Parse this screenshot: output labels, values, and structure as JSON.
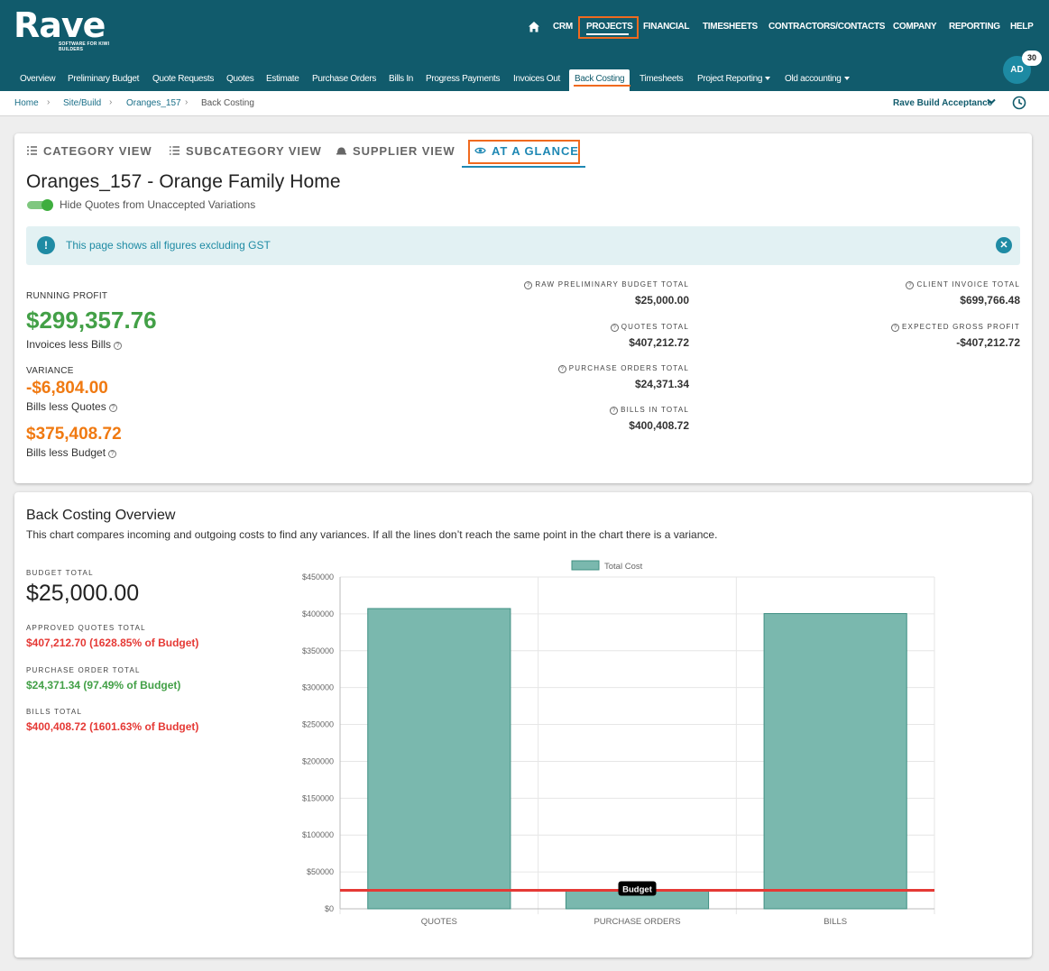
{
  "brand": {
    "name": "Rave",
    "tagline": "SOFTWARE FOR KIWI BUILDERS"
  },
  "main_nav": {
    "items": [
      "CRM",
      "PROJECTS",
      "FINANCIAL",
      "TIMESHEETS",
      "CONTRACTORS/CONTACTS",
      "COMPANY",
      "REPORTING",
      "HELP"
    ],
    "active": "PROJECTS"
  },
  "sub_nav": {
    "items": [
      "Overview",
      "Preliminary Budget",
      "Quote Requests",
      "Quotes",
      "Estimate",
      "Purchase Orders",
      "Bills In",
      "Progress Payments",
      "Invoices Out",
      "Back Costing",
      "Timesheets",
      "Project Reporting",
      "Old accounting"
    ],
    "active": "Back Costing"
  },
  "user": {
    "initials": "AD",
    "notification_count": "30"
  },
  "breadcrumb": {
    "items": [
      "Home",
      "Site/Build",
      "Oranges_157",
      "Back Costing"
    ]
  },
  "project_selector": "Rave Build Acceptance",
  "tabs": {
    "items": [
      "CATEGORY VIEW",
      "SUBCATEGORY VIEW",
      "SUPPLIER VIEW",
      "AT A GLANCE"
    ],
    "active": "AT A GLANCE"
  },
  "project": {
    "title": "Oranges_157 - Orange Family Home",
    "hide_quotes_toggle_label": "Hide Quotes from Unaccepted Variations",
    "hide_quotes_toggle_on": true
  },
  "alert": {
    "icon": "!",
    "text": "This page shows all figures excluding GST"
  },
  "summary": {
    "running_profit_label": "RUNNING PROFIT",
    "running_profit": "$299,357.76",
    "running_profit_sub": "Invoices less Bills",
    "variance_label": "VARIANCE",
    "variance": "-$6,804.00",
    "variance_sub": "Bills less Quotes",
    "budget_variance": "$375,408.72",
    "budget_variance_sub": "Bills less Budget"
  },
  "totals_mid": [
    {
      "label": "RAW PRELIMINARY BUDGET TOTAL",
      "value": "$25,000.00"
    },
    {
      "label": "QUOTES TOTAL",
      "value": "$407,212.72"
    },
    {
      "label": "PURCHASE ORDERS TOTAL",
      "value": "$24,371.34"
    },
    {
      "label": "BILLS IN TOTAL",
      "value": "$400,408.72"
    }
  ],
  "totals_right": [
    {
      "label": "CLIENT INVOICE TOTAL",
      "value": "$699,766.48"
    },
    {
      "label": "EXPECTED GROSS PROFIT",
      "value": "-$407,212.72"
    }
  ],
  "overview": {
    "title": "Back Costing Overview",
    "description": "This chart compares incoming and outgoing costs to find any variances. If all the lines don’t reach the same point in the chart there is a variance.",
    "budget_total_label": "BUDGET TOTAL",
    "budget_total": "$25,000.00",
    "approved_quotes_label": "APPROVED QUOTES TOTAL",
    "approved_quotes": "$407,212.70 (1628.85% of Budget)",
    "po_total_label": "PURCHASE ORDER TOTAL",
    "po_total": "$24,371.34 (97.49% of Budget)",
    "bills_total_label": "BILLS TOTAL",
    "bills_total": "$400,408.72 (1601.63% of Budget)"
  },
  "colors": {
    "header": "#115b6c",
    "accent_orange": "#f06a1f",
    "profit_green": "#43a047",
    "variance_orange": "#f07a12",
    "over_budget_red": "#e53935",
    "bar_fill": "#7ab8ae",
    "bar_stroke": "#3f8f82",
    "budget_line": "#e53935"
  },
  "icons": [
    "home-icon",
    "list-icon",
    "sublist-icon",
    "hardhat-icon",
    "eye-icon",
    "info-icon",
    "close-icon",
    "help-circle-icon",
    "chevron-down-icon",
    "clock-icon"
  ],
  "chart_data": {
    "type": "bar",
    "categories": [
      "QUOTES",
      "PURCHASE ORDERS",
      "BILLS"
    ],
    "series": [
      {
        "name": "Total Cost",
        "values": [
          407212.72,
          24371.34,
          400408.72
        ]
      }
    ],
    "reference_line": {
      "label": "Budget",
      "value": 25000
    },
    "ylim": [
      0,
      450000
    ],
    "yticks": [
      "$0",
      "$50000",
      "$100000",
      "$150000",
      "$200000",
      "$250000",
      "$300000",
      "$350000",
      "$400000",
      "$450000"
    ],
    "grid": true,
    "legend": "top"
  }
}
